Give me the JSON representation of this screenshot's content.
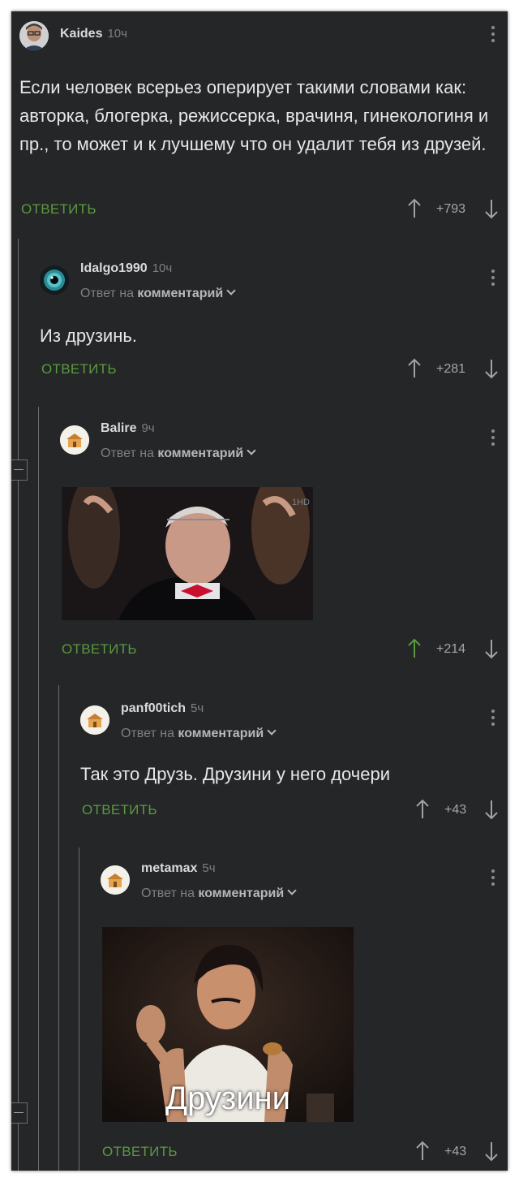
{
  "comments": [
    {
      "username": "Kaides",
      "time": "10ч",
      "text": "Если человек всерьез оперирует такими словами как: авторка, блогерка, режиссерка, врачиня, гинекологиня и пр., то может и к лучшему что он удалит тебя из друзей.",
      "reply_label": "ОТВЕТИТЬ",
      "rating": "+793",
      "avatar_icon": "user-avatar-icon"
    },
    {
      "username": "Idalgo1990",
      "time": "10ч",
      "reply_to_prefix": "Ответ на",
      "reply_to_link": "комментарий",
      "text": "Из друзинь.",
      "reply_label": "ОТВЕТИТЬ",
      "rating": "+281",
      "avatar_icon": "eye-avatar-icon"
    },
    {
      "username": "Balire",
      "time": "9ч",
      "reply_to_prefix": "Ответ на",
      "reply_to_link": "комментарий",
      "reply_label": "ОТВЕТИТЬ",
      "rating": "+214",
      "avatar_icon": "default-avatar-icon",
      "upvoted": true
    },
    {
      "username": "panf00tich",
      "time": "5ч",
      "reply_to_prefix": "Ответ на",
      "reply_to_link": "комментарий",
      "text": "Так это Друзь. Друзини у него дочери",
      "reply_label": "ОТВЕТИТЬ",
      "rating": "+43",
      "avatar_icon": "default-avatar-icon"
    },
    {
      "username": "metamax",
      "time": "5ч",
      "reply_to_prefix": "Ответ на",
      "reply_to_link": "комментарий",
      "image_caption": "Друзини",
      "reply_label": "ОТВЕТИТЬ",
      "rating": "+43",
      "avatar_icon": "default-avatar-icon"
    }
  ],
  "colors": {
    "background": "#242628",
    "accent_green": "#5a9a3f",
    "text": "#e6e7e9",
    "muted": "#7d8085"
  }
}
